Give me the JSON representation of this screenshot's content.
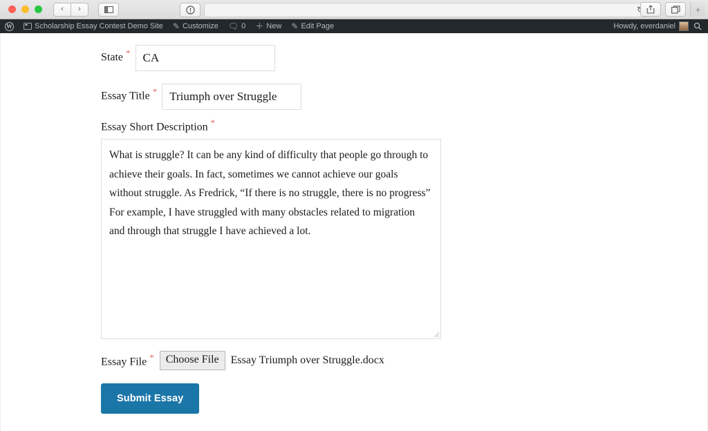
{
  "browser": {
    "traffic_lights": [
      "close",
      "minimize",
      "maximize"
    ],
    "back_label": "‹",
    "forward_label": "›",
    "sidebar_label": "▥",
    "reader_label": "ⓘ",
    "url_value": "",
    "url_placeholder": "",
    "reload_label": "↻",
    "share_label": "⇧",
    "tabs_label": "⧉",
    "newtab_label": "+"
  },
  "adminbar": {
    "wp_logo_label": "W",
    "site_name": "Scholarship Essay Contest Demo Site",
    "customize_label": "Customize",
    "comments_count": "0",
    "new_label": "New",
    "edit_page_label": "Edit Page",
    "howdy_label": "Howdy, everdaniel",
    "search_label": "⌕",
    "bar_color": "#23282d",
    "text_color": "#b4b9be"
  },
  "form": {
    "required_marker": "*",
    "required_color": "#dd6b66",
    "state": {
      "label": "State",
      "value": "CA",
      "placeholder": ""
    },
    "essay_title": {
      "label": "Essay Title",
      "value": "Triumph over Struggle",
      "placeholder": ""
    },
    "essay_description": {
      "label": "Essay Short Description",
      "value": "What is struggle? It can be any kind of difficulty that people go through to achieve their goals. In fact, sometimes we cannot achieve our goals without struggle. As Fredrick, “If there is no struggle, there is no progress” For example, I have struggled with many obstacles related to migration and through that struggle I have achieved a lot.",
      "placeholder": ""
    },
    "essay_file": {
      "label": "Essay File",
      "button_label": "Choose File",
      "file_name": "Essay Triumph over Struggle.docx"
    },
    "submit": {
      "label": "Submit Essay",
      "color": "#1b76a8"
    }
  }
}
